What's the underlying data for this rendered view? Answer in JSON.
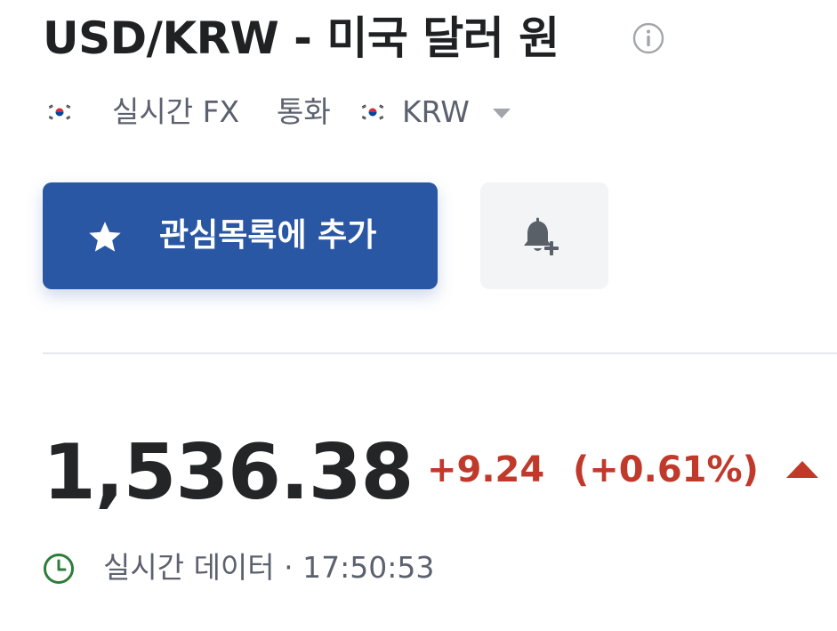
{
  "header": {
    "title": "USD/KRW - 미국 달러 원",
    "info_icon": "info-circle-icon"
  },
  "subheader": {
    "flag_icon": "south-korea-flag-icon",
    "realtime_label": "실시간 FX",
    "category_label": "통화",
    "currency_label": "KRW",
    "dropdown_icon": "caret-down-icon"
  },
  "actions": {
    "watchlist_label": "관심목록에 추가",
    "watchlist_icon": "star-icon",
    "watchlist_color": "#2a57a4",
    "alert_icon": "bell-plus-icon"
  },
  "quote": {
    "price": "1,536.38",
    "change": "+9.24",
    "change_percent": "(+0.61%)",
    "direction_icon": "triangle-up-icon",
    "change_color": "#c0392b"
  },
  "status": {
    "icon": "clock-icon",
    "text": "실시간 데이터 · 17:50:53"
  }
}
